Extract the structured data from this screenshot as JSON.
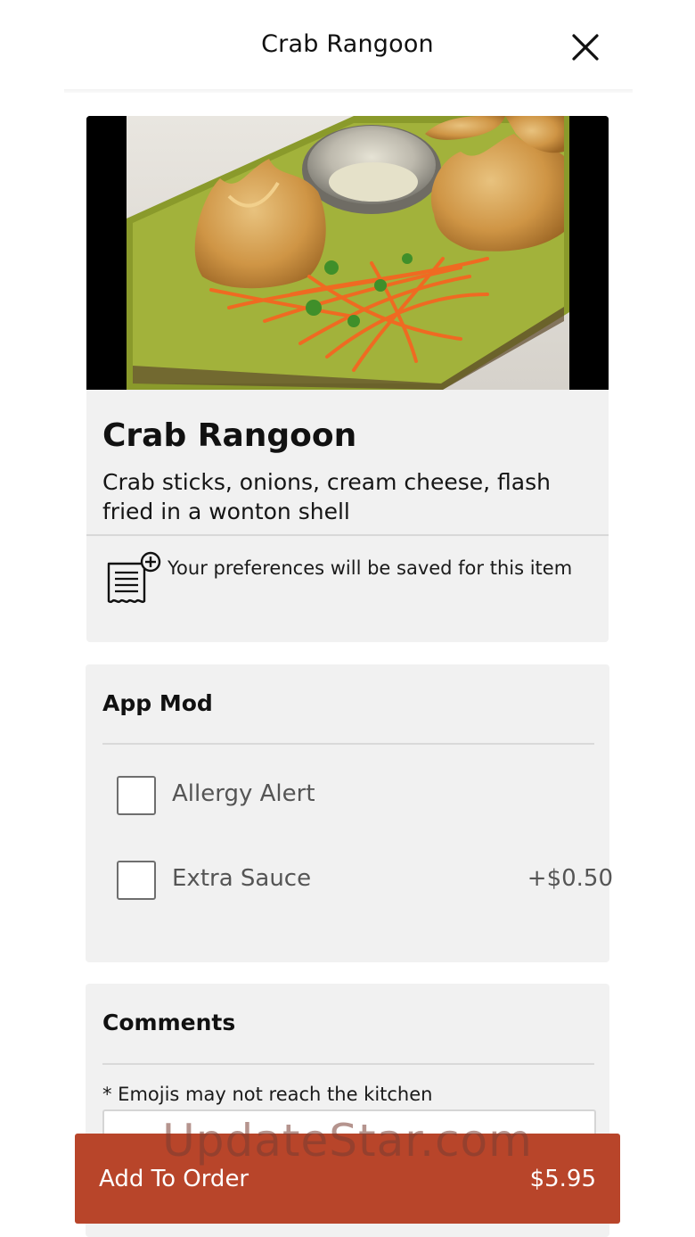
{
  "header": {
    "title": "Crab Rangoon",
    "close_icon": "close-icon"
  },
  "item": {
    "name": "Crab Rangoon",
    "description": "Crab sticks, onions, cream cheese, flash fried in a wonton shell",
    "preferences_note": "Your preferences will be saved for this item",
    "preferences_icon": "receipt-plus-icon"
  },
  "modifiers": {
    "title": "App Mod",
    "options": [
      {
        "label": "Allergy Alert",
        "price": "",
        "checked": false
      },
      {
        "label": "Extra Sauce",
        "price": "+$0.50",
        "checked": false
      }
    ]
  },
  "comments": {
    "title": "Comments",
    "note": "* Emojis may not reach the kitchen",
    "value": ""
  },
  "order_button": {
    "label": "Add To Order",
    "price": "$5.95"
  },
  "watermark": "UpdateStar.com",
  "colors": {
    "accent": "#b8452a",
    "card_bg": "#f1f1f1"
  }
}
